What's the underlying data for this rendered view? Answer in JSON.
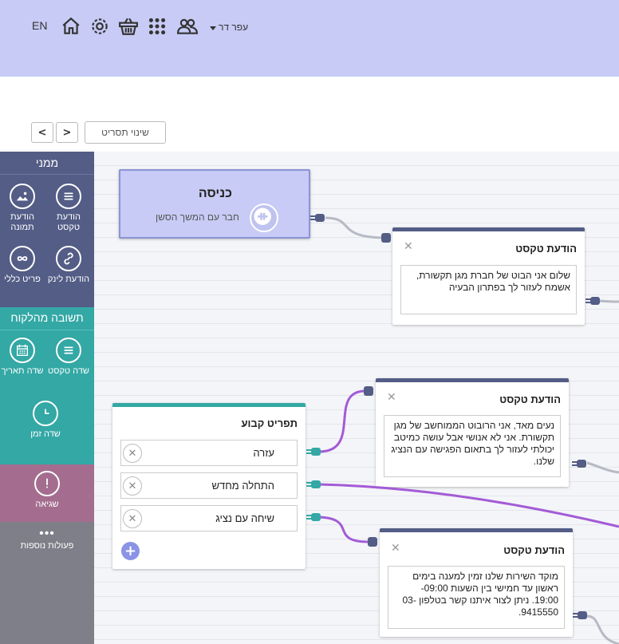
{
  "header": {
    "lang": "EN",
    "user_name": "עפר דר",
    "icons": [
      "home-icon",
      "gear-icon",
      "basket-icon",
      "apps-grid-icon",
      "users-icon"
    ]
  },
  "toolbar": {
    "change_script_label": "שינוי תסריט"
  },
  "sidebar": {
    "managed": {
      "title": "ממני",
      "items": [
        {
          "label": "הודעת טקסט",
          "icon": "text-lines-icon"
        },
        {
          "label": "הודעת תמונה",
          "icon": "image-icon"
        },
        {
          "label": "הודעת לינק",
          "icon": "link-icon"
        },
        {
          "label": "פריט כללי",
          "icon": "infinity-icon"
        }
      ]
    },
    "customer_response": {
      "title": "תשובה מהלקוח",
      "items": [
        {
          "label": "שדה טקסט",
          "icon": "text-lines-icon"
        },
        {
          "label": "שדה תאריך",
          "icon": "calendar-icon"
        },
        {
          "label": "שדה זמן",
          "icon": "clock-icon"
        }
      ]
    },
    "error": {
      "label": "שגיאה",
      "icon": "exclamation-icon"
    },
    "more": {
      "label": "פעולות נוספות",
      "icon": "dots-icon"
    }
  },
  "entry": {
    "title": "כניסה",
    "subtitle": "חבר עם המשך הסשן"
  },
  "nodes": [
    {
      "title": "הודעת טקסט",
      "body": "שלום אני הבוט של חברת מגן תקשורת, אשמח לעזור לך בפתרון הבעיה"
    },
    {
      "title": "הודעת טקסט",
      "body": "נעים מאד, אני הרובוט הממוחשב של מגן תקשורת. אני לא אנושי אבל עושה כמיטב יכולתי לעזור לך בתאום הפגישה עם הנציג שלנו."
    },
    {
      "title": "הודעת טקסט",
      "body": "מוקד השירות שלנו זמין למענה בימים ראשון עד חמישי בין השעות 09:00- 19:00. ניתן לצור איתנו קשר בטלפון 03-9415550."
    }
  ],
  "fixed_menu": {
    "title": "תפריט קבוע",
    "options": [
      "עזרה",
      "התחלה מחדש",
      "שיחה עם נציג"
    ]
  },
  "colors": {
    "header_bg": "#c7cbf5",
    "managed_bg": "#535d86",
    "response_bg": "#33a8a5",
    "error_bg": "#a46d8f",
    "wire_purple": "#a35bd6",
    "wire_gray": "#b7bac4"
  }
}
